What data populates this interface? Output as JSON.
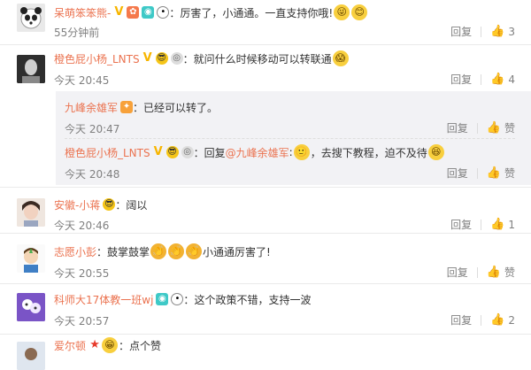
{
  "comments": [
    {
      "user": "呆萌笨笨熊-",
      "text": "厉害了，小通通。一直支持你哦!",
      "time": "55分钟前",
      "reply": "回复",
      "likes": "3"
    },
    {
      "user": "橙色屁小杨_LNTS",
      "text": "就问什么时候移动可以转联通",
      "time": "今天 20:45",
      "reply": "回复",
      "likes": "4"
    },
    {
      "user": "安徽-小蒋",
      "text": "阔以",
      "time": "今天 20:46",
      "reply": "回复",
      "likes": "1"
    },
    {
      "user": "志愿小彭",
      "text": "鼓掌鼓掌",
      "text2": "小通通厉害了!",
      "time": "今天 20:55",
      "reply": "回复",
      "likes": "赞"
    },
    {
      "user": "科师大17体教一班wj",
      "text": "这个政策不错，支持一波",
      "time": "今天 20:57",
      "reply": "回复",
      "likes": "2"
    },
    {
      "user": "爱尔顿",
      "text": "点个赞"
    }
  ],
  "replies": [
    {
      "user": "九峰余雄军",
      "text": "已经可以转了。",
      "time": "今天 20:47",
      "reply": "回复",
      "like": "赞"
    },
    {
      "user": "橙色屁小杨_LNTS",
      "reply_word": "回复",
      "mention": "@九峰余雄军",
      "text": "去搜下教程，迫不及待",
      "time": "今天 20:48",
      "reply": "回复",
      "like": "赞"
    }
  ],
  "colors": {
    "username": "#eb7350",
    "time": "#808080",
    "reply_bg": "#f2f2f5"
  },
  "icons": [
    "thumb-up-icon",
    "verified-v-icon",
    "vip-icon",
    "eye-badge-icon",
    "panda-icon",
    "cool-emoji-icon",
    "medal-icon",
    "star-icon"
  ]
}
